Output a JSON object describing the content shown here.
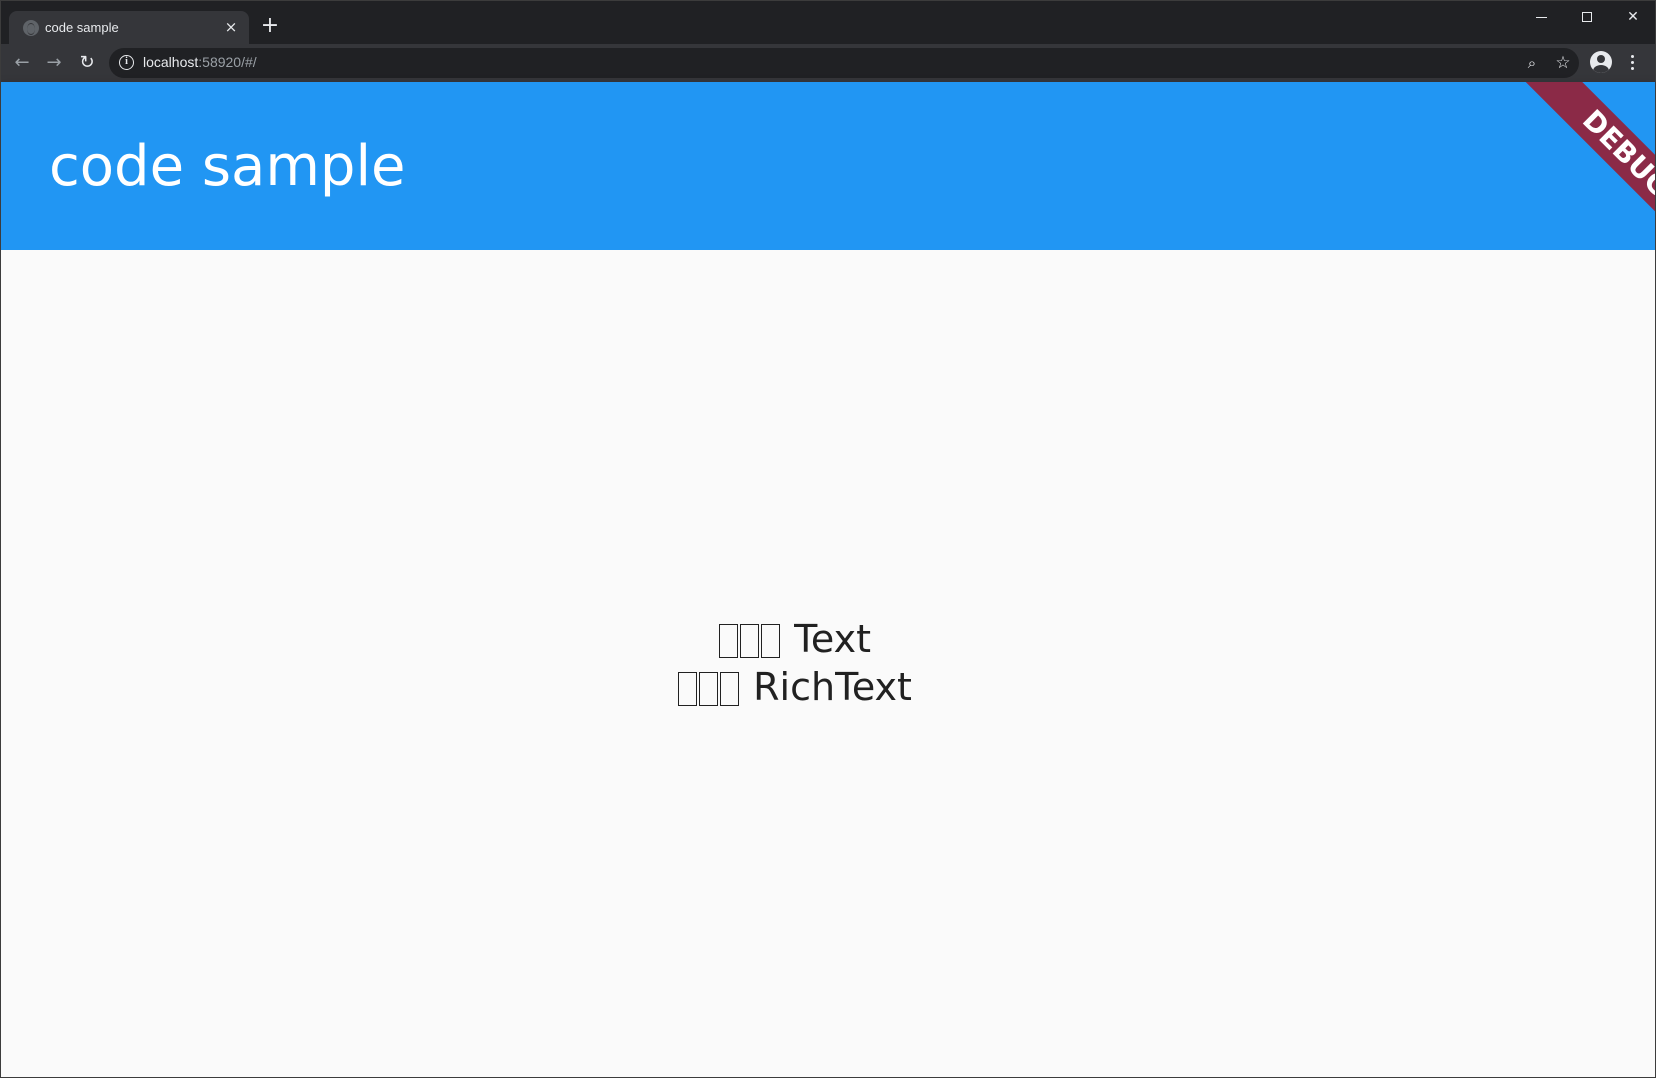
{
  "browser": {
    "tab_title": "code sample",
    "tab_close": "×",
    "new_tab": "+",
    "url_host": "localhost",
    "url_rest": ":58920/#/",
    "window_controls": {
      "minimize": "",
      "maximize": "",
      "close": "✕"
    }
  },
  "app": {
    "title": "code sample",
    "debug_banner": "DEBUG",
    "lines": [
      {
        "suffix": " Text"
      },
      {
        "suffix": " RichText"
      }
    ]
  },
  "colors": {
    "appbar": "#2196f3",
    "banner": "#8b2a47",
    "background": "#fafafa",
    "chrome_dark": "#202124",
    "chrome_toolbar": "#35363a"
  },
  "icons": [
    "globe-icon",
    "back-arrow-icon",
    "forward-arrow-icon",
    "reload-icon",
    "info-icon",
    "zoom-icon",
    "star-icon",
    "profile-icon",
    "kebab-menu-icon"
  ]
}
